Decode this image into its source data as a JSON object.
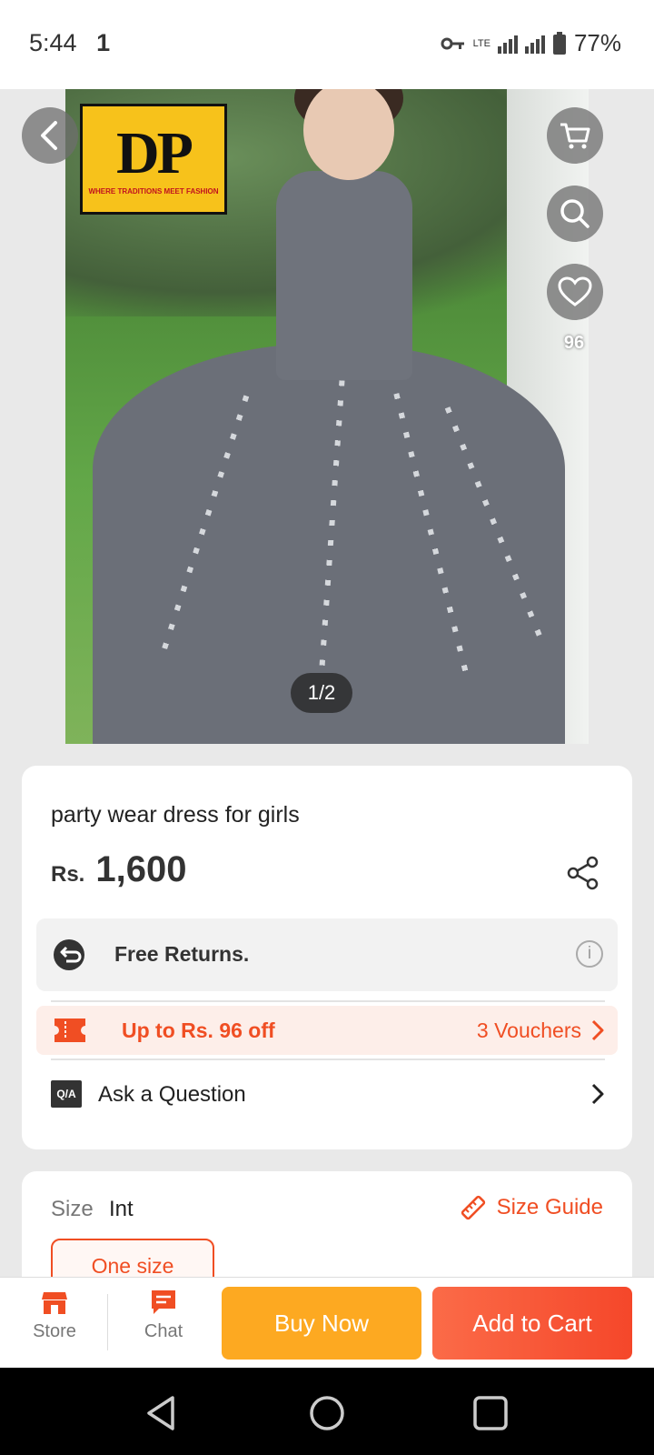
{
  "status_bar": {
    "time": "5:44",
    "notification": "1",
    "network": "LTE",
    "battery": "77%"
  },
  "hero": {
    "brand_logo_text": "DP",
    "brand_tagline": "WHERE TRADITIONS MEET FASHION",
    "favorite_count": "96",
    "page_indicator": "1/2"
  },
  "product": {
    "title": "party wear dress for girls",
    "currency": "Rs.",
    "price": "1,600",
    "returns_label": "Free Returns.",
    "voucher_label": "Up to Rs. 96 off",
    "voucher_count": "3 Vouchers",
    "ask_label": "Ask a Question",
    "qa_badge": "Q/A"
  },
  "size": {
    "label": "Size",
    "value": "Int",
    "guide_label": "Size Guide",
    "option": "One size"
  },
  "action_bar": {
    "store_label": "Store",
    "chat_label": "Chat",
    "buy_now": "Buy Now",
    "add_to_cart": "Add to Cart"
  },
  "colors": {
    "accent_orange": "#f04e23",
    "buy_now": "#fda921",
    "add_to_cart": "#f5472a"
  }
}
